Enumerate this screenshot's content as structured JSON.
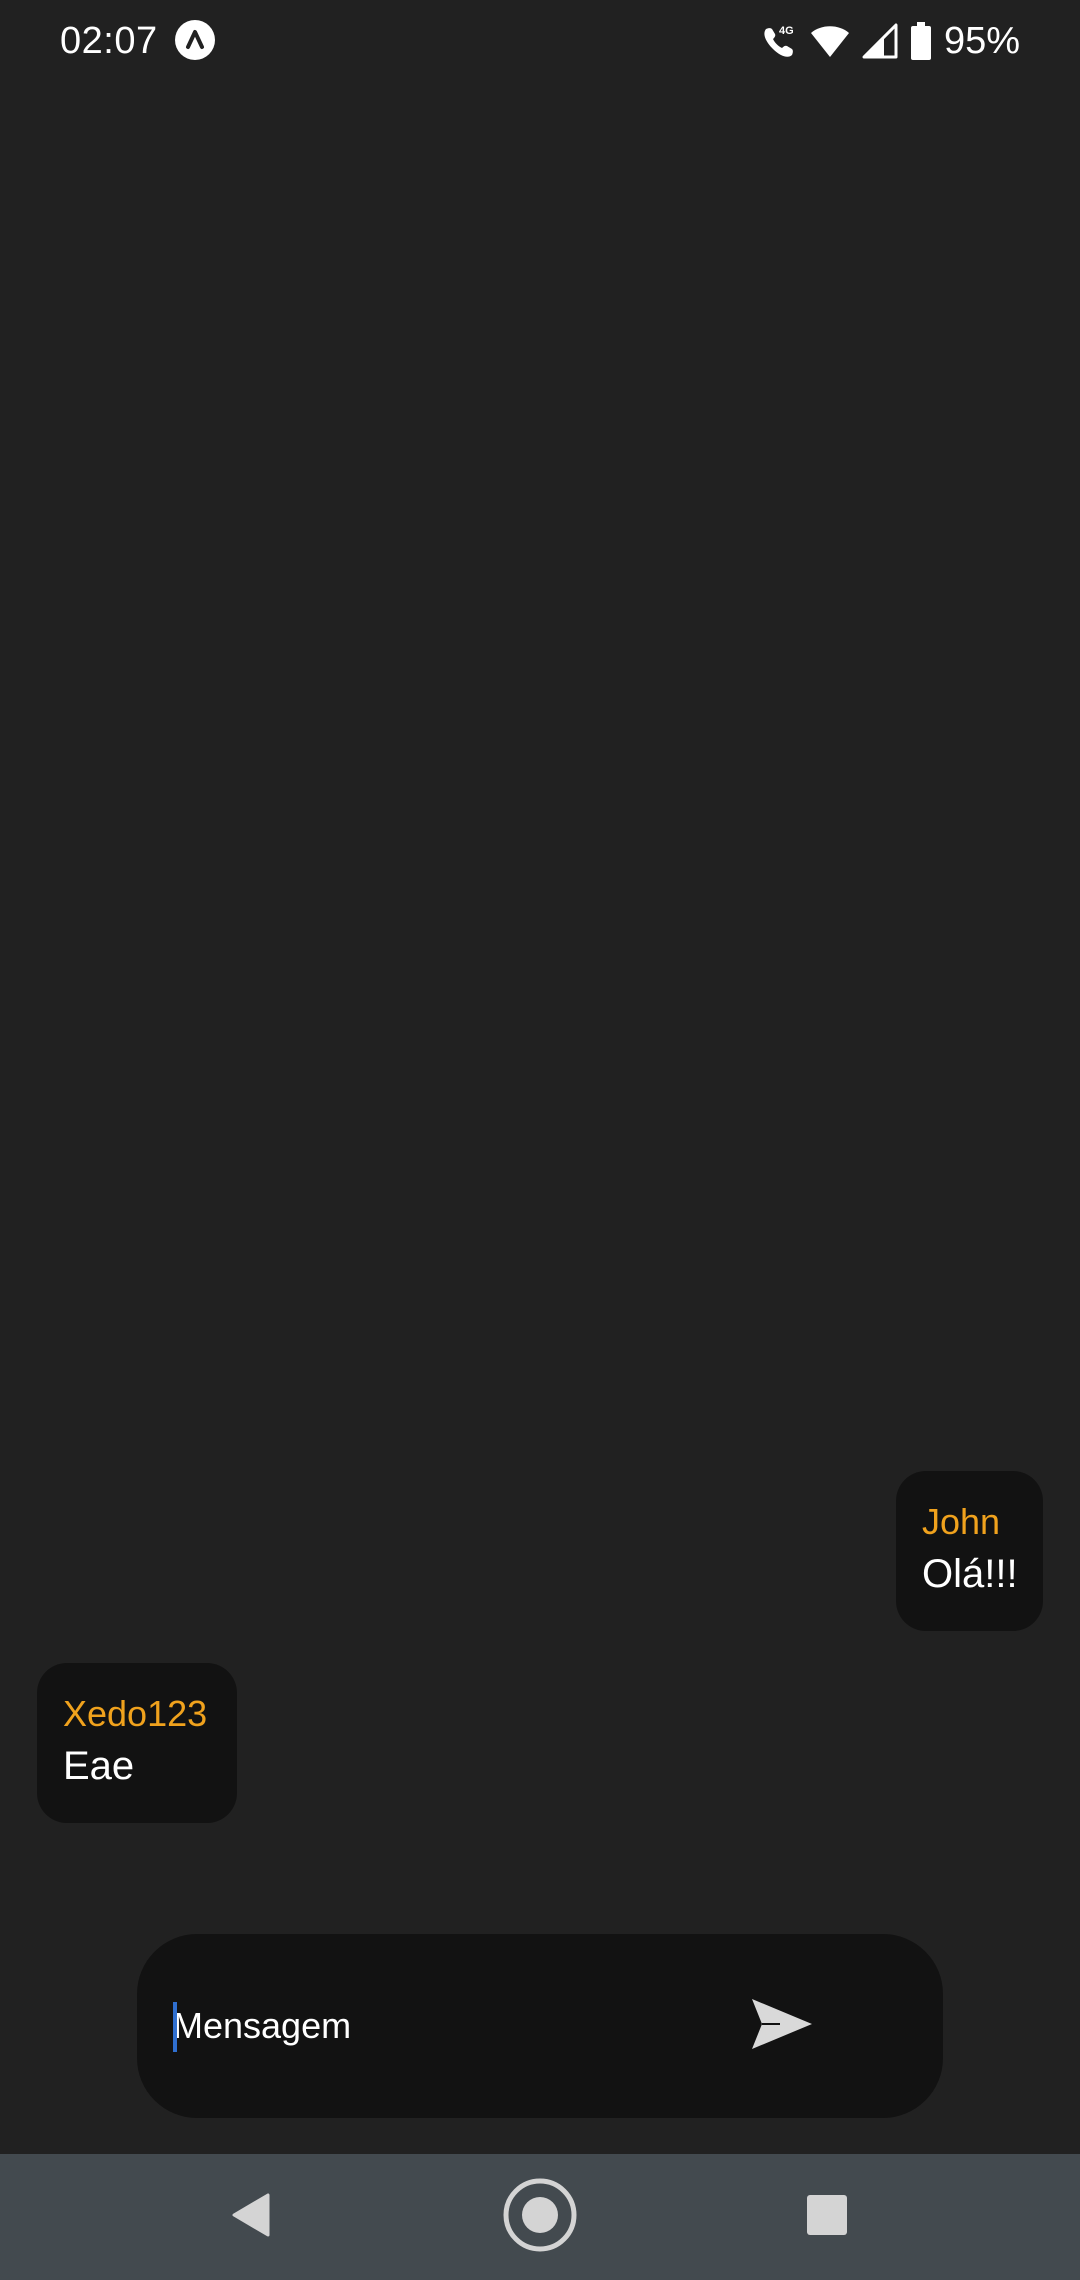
{
  "status_bar": {
    "time": "02:07",
    "network_type": "4G",
    "battery_percent": "95%"
  },
  "messages": [
    {
      "sender": "John",
      "text": "Olá!!!",
      "align": "right"
    },
    {
      "sender": "Xedo123",
      "text": "Eae",
      "align": "left"
    }
  ],
  "composer": {
    "placeholder": "Mensagem",
    "value": ""
  },
  "icons": {
    "app": "app-notification-icon",
    "call": "volte-call-icon",
    "wifi": "wifi-icon",
    "signal": "cell-signal-icon",
    "battery": "battery-icon",
    "send": "send-icon",
    "back": "back-icon",
    "home": "home-icon",
    "recents": "recents-icon"
  },
  "colors": {
    "background": "#212121",
    "bubble": "#121212",
    "sender_name": "#f0a21d",
    "nav_bar": "#434a4f"
  }
}
